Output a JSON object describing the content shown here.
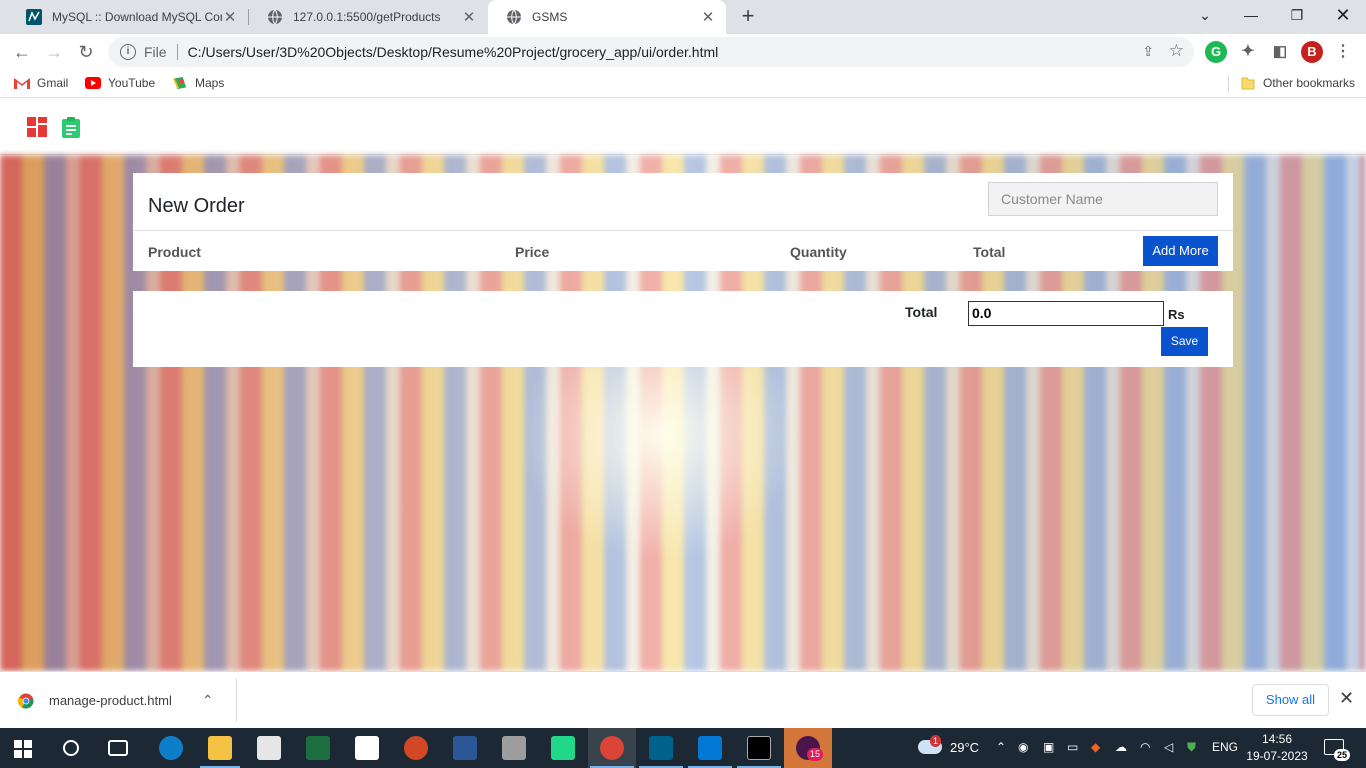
{
  "browser": {
    "tabs": [
      {
        "title": "MySQL :: Download MySQL Conn",
        "active": false
      },
      {
        "title": "127.0.0.1:5500/getProducts",
        "active": false
      },
      {
        "title": "GSMS",
        "active": true
      }
    ],
    "omnibox": {
      "scheme": "File",
      "url": "C:/Users/User/3D%20Objects/Desktop/Resume%20Project/grocery_app/ui/order.html"
    },
    "profile_initial": "B",
    "bookmarks": [
      "Gmail",
      "YouTube",
      "Maps"
    ],
    "other_bookmarks": "Other bookmarks"
  },
  "page": {
    "title": "New Order",
    "customer_placeholder": "Customer Name",
    "columns": [
      "Product",
      "Price",
      "Quantity",
      "Total"
    ],
    "add_more": "Add More",
    "total_label": "Total",
    "total_value": "0.0",
    "currency": "Rs",
    "save": "Save"
  },
  "downloads": {
    "file": "manage-product.html",
    "show_all": "Show all"
  },
  "taskbar": {
    "weather": "29°C",
    "weather_badge": "1",
    "lang": "ENG",
    "time": "14:56",
    "date": "19-07-2023",
    "notifications": "25",
    "slack_badge": "15"
  }
}
